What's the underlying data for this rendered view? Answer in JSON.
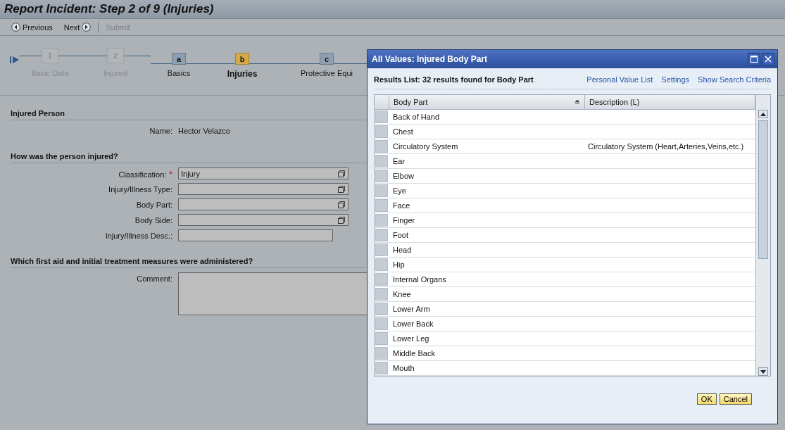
{
  "window": {
    "title": "Report Incident: Step 2 of 9 (Injuries)"
  },
  "toolbar": [
    {
      "label": "Previous",
      "kind": "prev",
      "disabled": false
    },
    {
      "label": "Next",
      "kind": "next",
      "disabled": false
    },
    {
      "label": "Submit",
      "kind": "plain",
      "disabled": true
    }
  ],
  "roadmap": [
    {
      "kind": "main",
      "key": "1",
      "label": "Basic Data",
      "disabled": true,
      "selected": false
    },
    {
      "kind": "main",
      "key": "2",
      "label": "Injured",
      "disabled": true,
      "selected": false
    },
    {
      "kind": "sub",
      "key": "a",
      "label": "Basics",
      "disabled": false,
      "selected": false
    },
    {
      "kind": "sub",
      "key": "b",
      "label": "Injuries",
      "disabled": false,
      "selected": true
    },
    {
      "kind": "sub",
      "key": "c",
      "label": "Protective Equi",
      "disabled": false,
      "selected": false
    }
  ],
  "sections": [
    {
      "title": "Injured Person",
      "fields": [
        {
          "kind": "display",
          "label": "Name:",
          "value": "Hector Velazco"
        }
      ]
    },
    {
      "title": "How was the person injured?",
      "fields": [
        {
          "kind": "valuehelp",
          "label": "Classification:",
          "value": "Injury",
          "required_mark": "*"
        },
        {
          "kind": "valuehelp",
          "label": "Injury/Illness Type:"
        },
        {
          "kind": "valuehelp",
          "label": "Body Part:"
        },
        {
          "kind": "valuehelp",
          "label": "Body Side:"
        },
        {
          "kind": "text",
          "label": "Injury/Illness Desc.:"
        }
      ]
    },
    {
      "title": "Which first aid and initial treatment measures were administered?",
      "fields": [
        {
          "kind": "textarea",
          "label": "Comment:"
        }
      ]
    }
  ],
  "dialog": {
    "title": "All Values: Injured Body Part",
    "results": "Results List: 32 results found for Body Part",
    "links": [
      "Personal Value List",
      "Settings",
      "Show Search Criteria"
    ],
    "columns": [
      "Body Part",
      "Description (L)"
    ],
    "rows": [
      [
        "Back of Hand",
        ""
      ],
      [
        "Chest",
        ""
      ],
      [
        "Circulatory System",
        "Circulatory System (Heart,Arteries,Veins,etc.)"
      ],
      [
        "Ear",
        ""
      ],
      [
        "Elbow",
        ""
      ],
      [
        "Eye",
        ""
      ],
      [
        "Face",
        ""
      ],
      [
        "Finger",
        ""
      ],
      [
        "Foot",
        ""
      ],
      [
        "Head",
        ""
      ],
      [
        "Hip",
        ""
      ],
      [
        "Internal Organs",
        ""
      ],
      [
        "Knee",
        ""
      ],
      [
        "Lower Arm",
        ""
      ],
      [
        "Lower Back",
        ""
      ],
      [
        "Lower Leg",
        ""
      ],
      [
        "Middle Back",
        ""
      ],
      [
        "Mouth",
        ""
      ]
    ],
    "buttons": [
      "OK",
      "Cancel"
    ]
  }
}
